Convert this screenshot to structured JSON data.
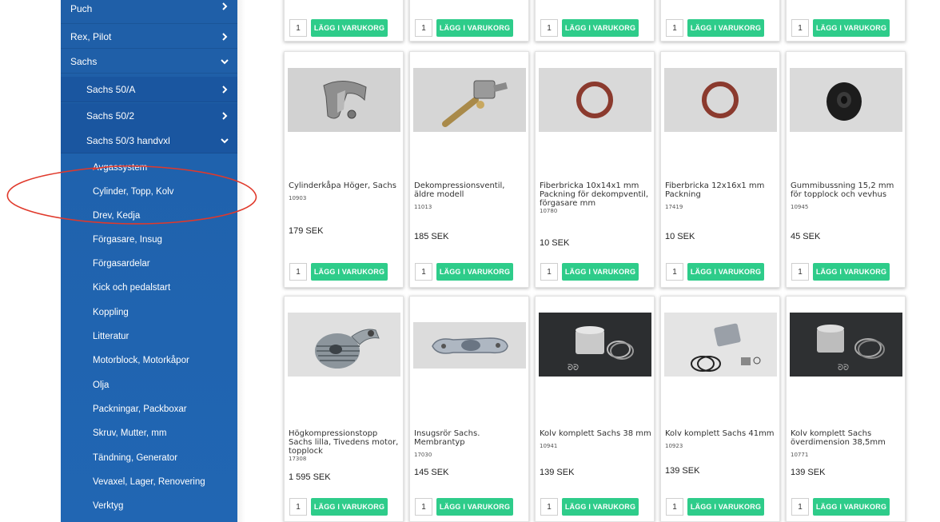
{
  "sidebar": {
    "items": [
      {
        "label": "Puch",
        "level": 1,
        "expanded": false
      },
      {
        "label": "Rex, Pilot",
        "level": 1,
        "expanded": false
      },
      {
        "label": "Sachs",
        "level": 1,
        "expanded": true
      },
      {
        "label": "Sachs 50/A",
        "level": 2,
        "expanded": false
      },
      {
        "label": "Sachs 50/2",
        "level": 2,
        "expanded": false
      },
      {
        "label": "Sachs 50/3 handvxl",
        "level": 2,
        "expanded": true
      },
      {
        "label": "Avgassystem",
        "level": 3
      },
      {
        "label": "Cylinder, Topp, Kolv",
        "level": 3
      },
      {
        "label": "Drev, Kedja",
        "level": 3
      },
      {
        "label": "Förgasare, Insug",
        "level": 3
      },
      {
        "label": "Förgasardelar",
        "level": 3
      },
      {
        "label": "Kick och pedalstart",
        "level": 3
      },
      {
        "label": "Koppling",
        "level": 3
      },
      {
        "label": "Litteratur",
        "level": 3
      },
      {
        "label": "Motorblock, Motorkåpor",
        "level": 3
      },
      {
        "label": "Olja",
        "level": 3
      },
      {
        "label": "Packningar, Packboxar",
        "level": 3
      },
      {
        "label": "Skruv, Mutter, mm",
        "level": 3
      },
      {
        "label": "Tändning, Generator",
        "level": 3
      },
      {
        "label": "Vevaxel, Lager, Renovering",
        "level": 3
      },
      {
        "label": "Verktyg",
        "level": 3
      }
    ]
  },
  "cart": {
    "button_label": "LÄGG I VARUKORG",
    "default_qty": "1"
  },
  "products": {
    "row1": [
      {
        "name": "Cylinderkåpa Höger, Sachs",
        "sku": "10903",
        "price": "179 SEK",
        "image": "cylinder-cover"
      },
      {
        "name": "Dekompressionsventil, äldre modell",
        "sku": "11013",
        "price": "185 SEK",
        "image": "decompression-valve"
      },
      {
        "name": "Fiberbricka 10x14x1 mm Packning för dekompventil, förgasare mm",
        "sku": "10780",
        "price": "10 SEK",
        "image": "fiber-washer"
      },
      {
        "name": "Fiberbricka 12x16x1 mm Packning",
        "sku": "17419",
        "price": "10 SEK",
        "image": "fiber-washer"
      },
      {
        "name": "Gummibussning 15,2 mm för topplock och vevhus",
        "sku": "10945",
        "price": "45 SEK",
        "image": "rubber-bushing"
      }
    ],
    "row2": [
      {
        "name": "Högkompressionstopp Sachs lilla, Tivedens motor, topplock",
        "sku": "17308",
        "price": "1 595 SEK",
        "image": "cylinder-head"
      },
      {
        "name": "Insugsrör Sachs. Membrantyp",
        "sku": "17030",
        "price": "145 SEK",
        "image": "intake-pipe"
      },
      {
        "name": "Kolv komplett Sachs 38 mm",
        "sku": "10941",
        "price": "139 SEK",
        "image": "piston-kit"
      },
      {
        "name": "Kolv komplett Sachs 41mm",
        "sku": "10923",
        "price": "139 SEK",
        "image": "piston-kit"
      },
      {
        "name": "Kolv komplett Sachs överdimension 38,5mm",
        "sku": "10771",
        "price": "139 SEK",
        "image": "piston-kit"
      }
    ]
  },
  "colors": {
    "sidebar": "#1f5fa8",
    "button": "#2ecc8a",
    "annotation": "#e0392b"
  }
}
